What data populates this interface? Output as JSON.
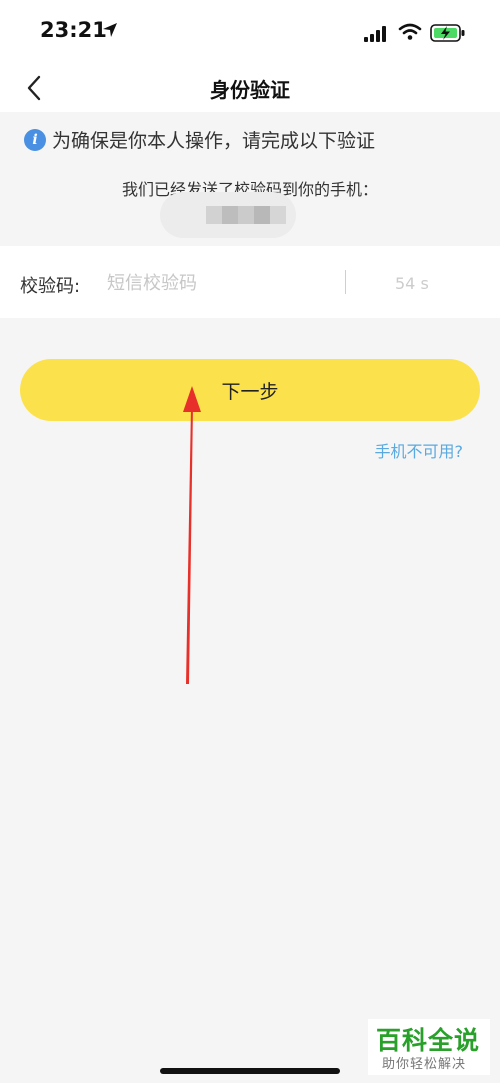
{
  "status_bar": {
    "time": "23:21"
  },
  "nav": {
    "title": "身份验证"
  },
  "notice": {
    "text": "为确保是你本人操作，请完成以下验证",
    "sent_text": "我们已经发送了校验码到你的手机："
  },
  "verification": {
    "label": "校验码:",
    "placeholder": "短信校验码",
    "value": "",
    "countdown": "54 s"
  },
  "actions": {
    "next_label": "下一步",
    "phone_unavailable": "手机不可用?"
  },
  "watermark": {
    "main": "百科全说",
    "sub": "助你轻松解决"
  },
  "colors": {
    "accent_button": "#fbe24c",
    "link": "#5aa9e0",
    "info_icon": "#4a90e2",
    "annotation_arrow": "#e8302a"
  }
}
